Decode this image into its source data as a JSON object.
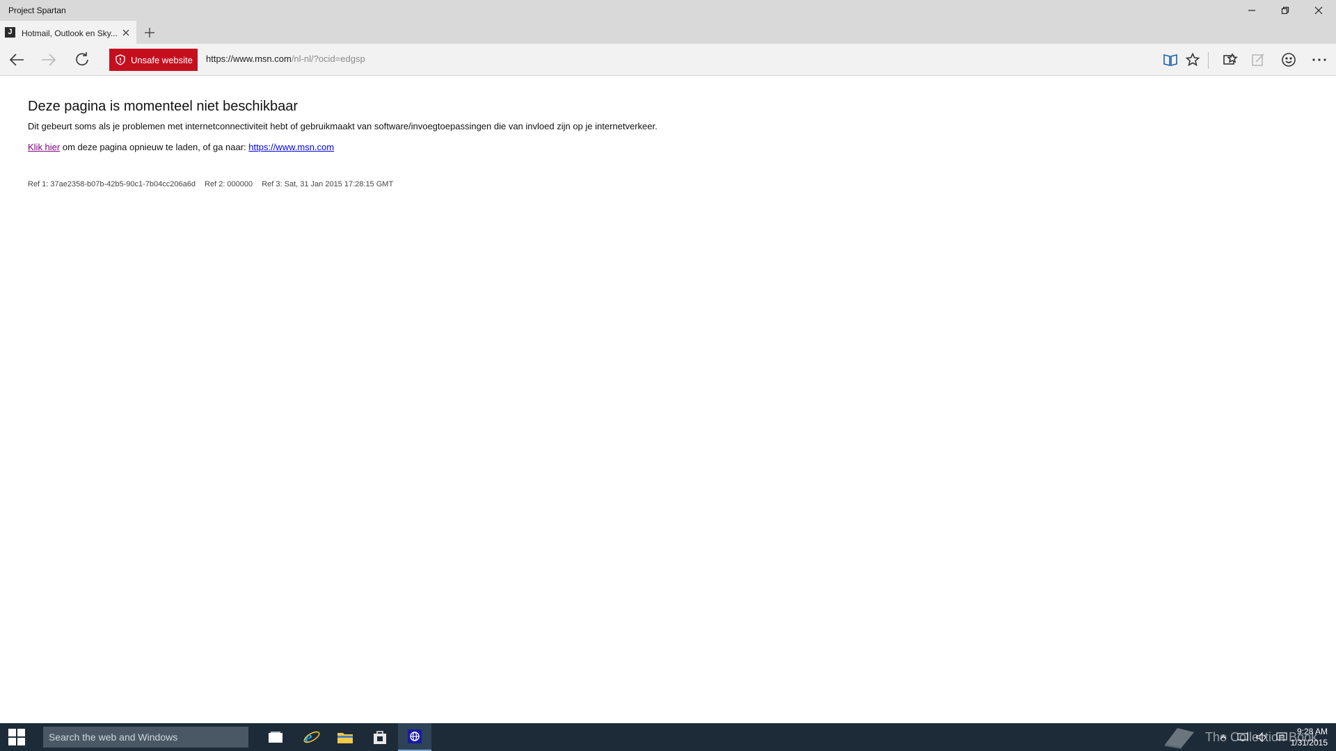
{
  "window": {
    "title": "Project Spartan"
  },
  "tab": {
    "title": "Hotmail, Outlook en Sky...",
    "favicon_letter": "J"
  },
  "navbar": {
    "unsafe_label": "Unsafe website",
    "address_domain": "https://www.msn.com",
    "address_path": "/nl-nl/?ocid=edgsp"
  },
  "page": {
    "heading": "Deze pagina is momenteel niet beschikbaar",
    "description": "Dit gebeurt soms als je problemen met internetconnectiviteit hebt of gebruikmaakt van software/invoegtoepassingen die van invloed zijn op je internetverkeer.",
    "reload_link": "Klik hier",
    "reload_text": " om deze pagina opnieuw te laden, of ga naar: ",
    "home_link": "https://www.msn.com",
    "ref1": "Ref 1: 37ae2358-b07b-42b5-90c1-7b04cc206a6d",
    "ref2": "Ref 2: 000000",
    "ref3": "Ref 3: Sat, 31 Jan 2015 17:28:15 GMT"
  },
  "taskbar": {
    "search_placeholder": "Search the web and Windows",
    "watermark": "The Collection Book",
    "time": "9:28 AM",
    "date": "1/31/2015"
  },
  "colors": {
    "unsafe_badge": "#c50f1f",
    "taskbar": "#1d2b38",
    "visited_link": "#800080",
    "link": "#0000ee"
  }
}
